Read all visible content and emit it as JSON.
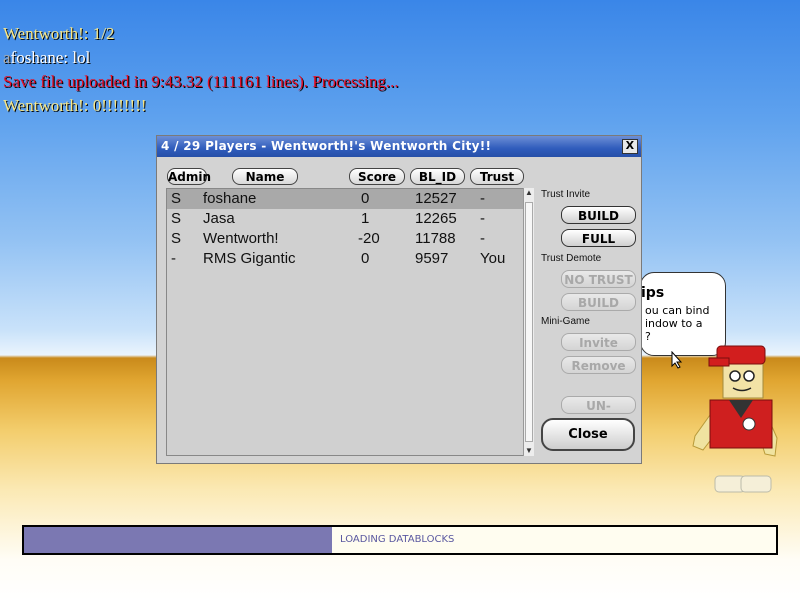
{
  "chat": {
    "lines": [
      {
        "name": "Wentworth!",
        "text": ": 1/2",
        "color": "#f5e68a"
      },
      {
        "prefix": "a",
        "name": "foshane",
        "text": ": lol",
        "color": "#ffffff"
      },
      {
        "text": "Save file uploaded in 9:43.32 (111161 lines).  Processing...",
        "color": "#e0102a"
      },
      {
        "name": "Wentworth!",
        "text": ": 0!!!!!!!!",
        "color": "#f5e68a"
      }
    ]
  },
  "window": {
    "title": "4 / 29 Players - Wentworth!'s Wentworth City!!",
    "close_glyph": "X",
    "columns": {
      "admin": "Admin",
      "name": "Name",
      "score": "Score",
      "bl_id": "BL_ID",
      "trust": "Trust"
    },
    "players": [
      {
        "admin": "S",
        "name": "foshane",
        "score": "0",
        "bl_id": "12527",
        "trust": "-",
        "selected": true
      },
      {
        "admin": "S",
        "name": "Jasa",
        "score": "1",
        "bl_id": "12265",
        "trust": "-"
      },
      {
        "admin": "S",
        "name": "Wentworth!",
        "score": "-20",
        "bl_id": "11788",
        "trust": "-"
      },
      {
        "admin": "-",
        "name": "RMS Gigantic",
        "score": "0",
        "bl_id": "9597",
        "trust": "You"
      }
    ],
    "side": {
      "trust_invite_label": "Trust Invite",
      "build_btn": "BUILD",
      "full_btn": "FULL",
      "trust_demote_label": "Trust Demote",
      "no_trust_btn": "NO TRUST",
      "build_demote_btn": "BUILD",
      "minigame_label": "Mini-Game",
      "invite_btn": "Invite",
      "remove_btn": "Remove",
      "unignore_btn": "UN-IGNORE",
      "close_btn": "Close"
    }
  },
  "tips": {
    "title": "ips",
    "body": "ou can bind\nindow to a\n?"
  },
  "progress": {
    "text": "LOADING DATABLOCKS",
    "fraction": 0.41
  }
}
